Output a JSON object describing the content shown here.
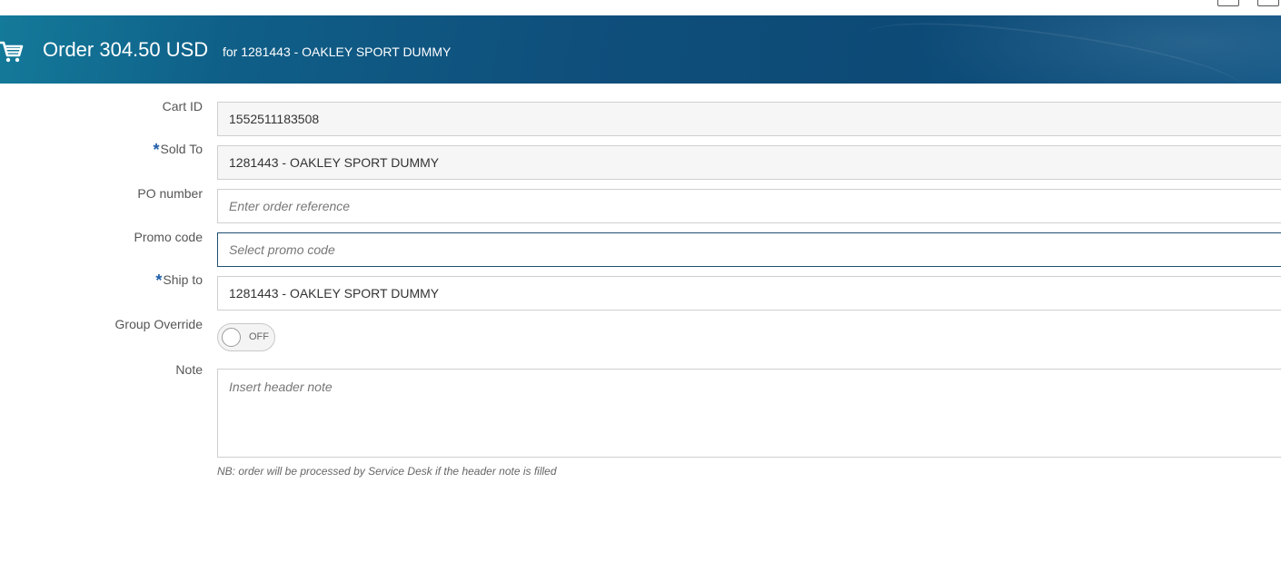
{
  "header": {
    "title": "Order 304.50 USD",
    "subtitle": "for 1281443 - OAKLEY SPORT DUMMY",
    "icon": "cart-icon"
  },
  "form": {
    "cart_id": {
      "label": "Cart ID",
      "value": "1552511183508"
    },
    "sold_to": {
      "required_mark": "*",
      "label": "Sold To",
      "value": "1281443 - OAKLEY SPORT DUMMY"
    },
    "po_number": {
      "label": "PO number",
      "value": "",
      "placeholder": "Enter order reference"
    },
    "promo_code": {
      "label": "Promo code",
      "value": "",
      "placeholder": "Select promo code"
    },
    "ship_to": {
      "required_mark": "*",
      "label": "Ship to",
      "value": "1281443 - OAKLEY SPORT DUMMY"
    },
    "group_override": {
      "label": "Group Override",
      "state": "OFF"
    },
    "note": {
      "label": "Note",
      "value": "",
      "placeholder": "Insert header note"
    },
    "note_hint": "NB: order will be processed by Service Desk if the header note is filled"
  },
  "colors": {
    "header_start": "#147a9a",
    "header_end": "#0d4a76",
    "required": "#1f5fa8",
    "active_border": "#1d4f6f"
  }
}
